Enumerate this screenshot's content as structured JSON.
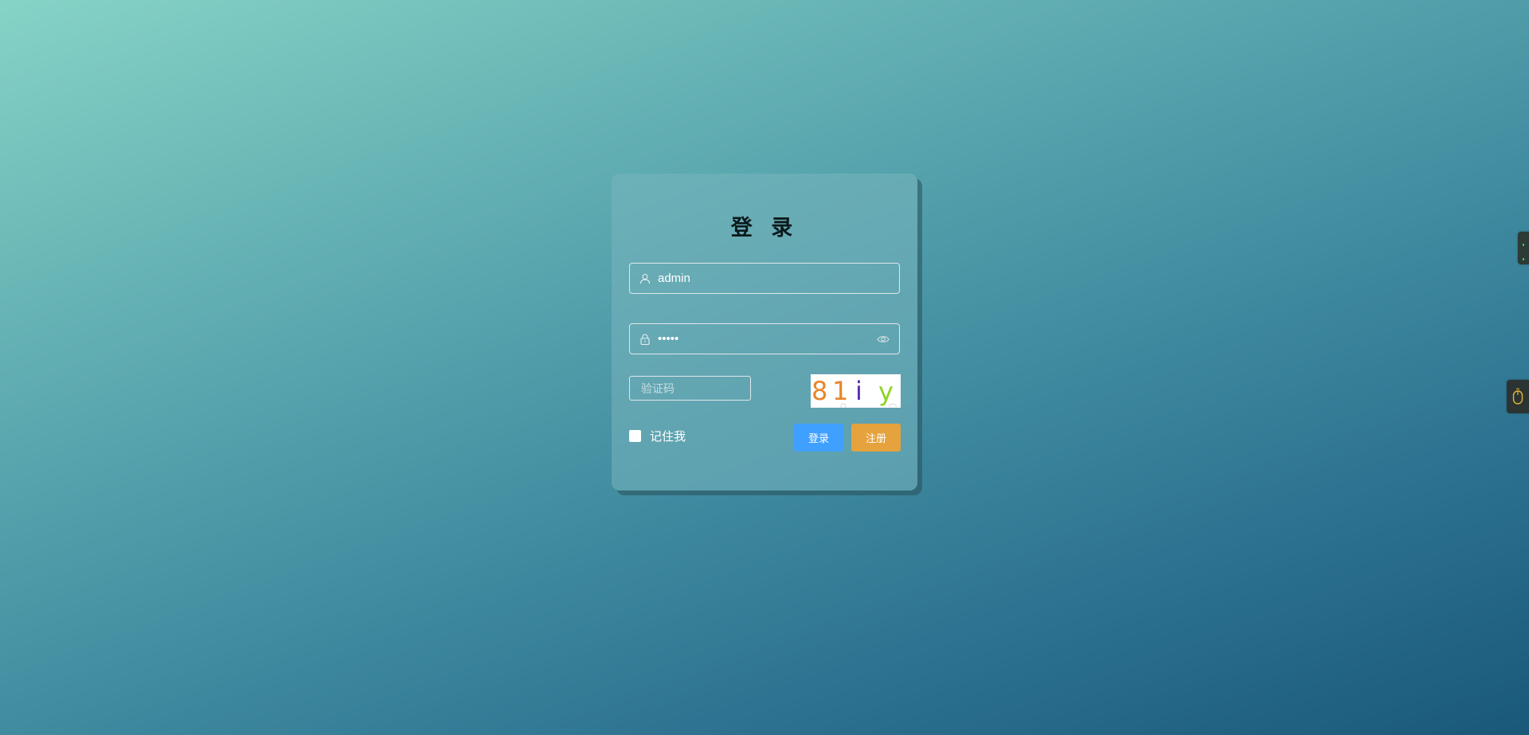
{
  "login": {
    "title": "登 录",
    "username": {
      "value": "admin",
      "icon": "user-icon"
    },
    "password": {
      "value": "•••••",
      "icon": "lock-icon",
      "toggle_icon": "eye-icon"
    },
    "captcha": {
      "placeholder": "验证码",
      "image_text": "81iy",
      "chars": [
        {
          "char": "8",
          "color": "#e8852a"
        },
        {
          "char": "1",
          "color": "#e8852a"
        },
        {
          "char": "i",
          "color": "#5b2bb5"
        },
        {
          "char": "y",
          "color": "#8ed322"
        }
      ]
    },
    "remember_label": "记住我",
    "remember_checked": false,
    "login_button": "登录",
    "register_button": "注册"
  },
  "colors": {
    "primary_button": "#40a0ff",
    "register_button": "#e6a23c"
  },
  "side_widgets": [
    "extension-handle-icon",
    "mouse-icon"
  ]
}
